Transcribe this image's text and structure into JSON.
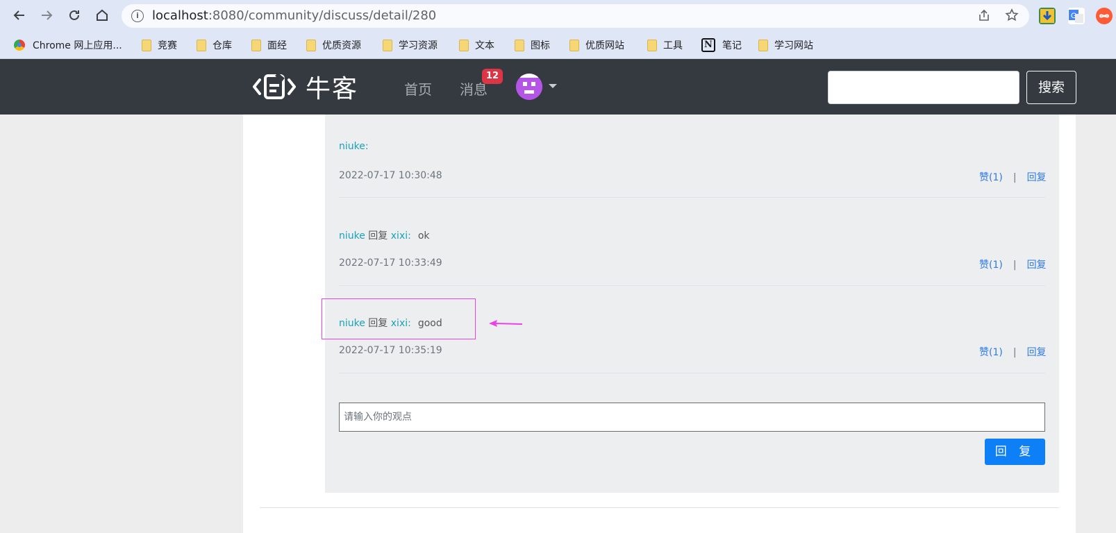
{
  "browser": {
    "url_host": "localhost",
    "url_rest": ":8080/community/discuss/detail/280",
    "bookmarks": [
      {
        "label": "Chrome 网上应用...",
        "icon": "chrome-icon"
      },
      {
        "label": "竞赛",
        "icon": "folder-icon"
      },
      {
        "label": "仓库",
        "icon": "folder-icon"
      },
      {
        "label": "面经",
        "icon": "folder-icon"
      },
      {
        "label": "优质资源",
        "icon": "folder-icon"
      },
      {
        "label": "学习资源",
        "icon": "folder-icon"
      },
      {
        "label": "文本",
        "icon": "folder-icon"
      },
      {
        "label": "图标",
        "icon": "folder-icon"
      },
      {
        "label": "优质网站",
        "icon": "folder-icon"
      },
      {
        "label": "工具",
        "icon": "folder-icon"
      },
      {
        "label": "笔记",
        "icon": "notion-icon"
      },
      {
        "label": "学习网站",
        "icon": "folder-icon"
      }
    ]
  },
  "header": {
    "logo_text": "牛客",
    "nav": {
      "home": "首页",
      "messages": "消息"
    },
    "message_badge": "12",
    "search_button": "搜索",
    "header_bg": "#343a40"
  },
  "comments": [
    {
      "user": "niuke",
      "sep": ":",
      "reply_word": "",
      "target": "",
      "message": "",
      "time": "2022-07-17 10:30:48",
      "like": "赞(1)",
      "reply": "回复"
    },
    {
      "user": "niuke",
      "reply_word": " 回复 ",
      "target": "xixi",
      "sep": ":",
      "message": "ok",
      "time": "2022-07-17 10:33:49",
      "like": "赞(1)",
      "reply": "回复"
    },
    {
      "user": "niuke",
      "reply_word": " 回复 ",
      "target": "xixi",
      "sep": ":",
      "message": "good",
      "time": "2022-07-17 10:35:19",
      "like": "赞(1)",
      "reply": "回复"
    }
  ],
  "reply_form": {
    "placeholder": "请输入你的观点",
    "submit_label": "回 复"
  },
  "colors": {
    "accent": "#0d7ff7",
    "username": "#17a2b8",
    "link": "#2d7be5",
    "highlight": "#ee3eea"
  }
}
